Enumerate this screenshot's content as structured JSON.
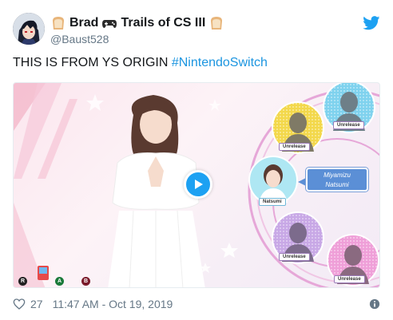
{
  "tweet": {
    "display_name": "Brad",
    "game_title": "Trails of CS III",
    "handle": "@Baust528",
    "text_prefix": "THIS IS FROM YS ORIGIN ",
    "hashtag": "#NintendoSwitch",
    "likes": "27",
    "timestamp": "11:47 AM - Oct 19, 2019"
  },
  "media": {
    "character_name_line1": "Miyamizu",
    "character_name_line2": "Natsumi",
    "portrait_caption": "Natsumi",
    "slots": [
      "Unrelease",
      "Unrelease",
      "Unrelease",
      "Unrelease"
    ],
    "controls": [
      "R",
      "A",
      "B"
    ]
  },
  "icons": {
    "brand": "twitter-bird-icon",
    "like": "heart-icon",
    "info": "info-icon",
    "play": "play-icon",
    "bread": "bread-emoji-icon",
    "gamepad": "gamepad-emoji-icon"
  },
  "colors": {
    "brand_blue": "#1da1f2",
    "hashtag_blue": "#1b95e0",
    "muted_gray": "#657786",
    "text": "#14171a"
  }
}
